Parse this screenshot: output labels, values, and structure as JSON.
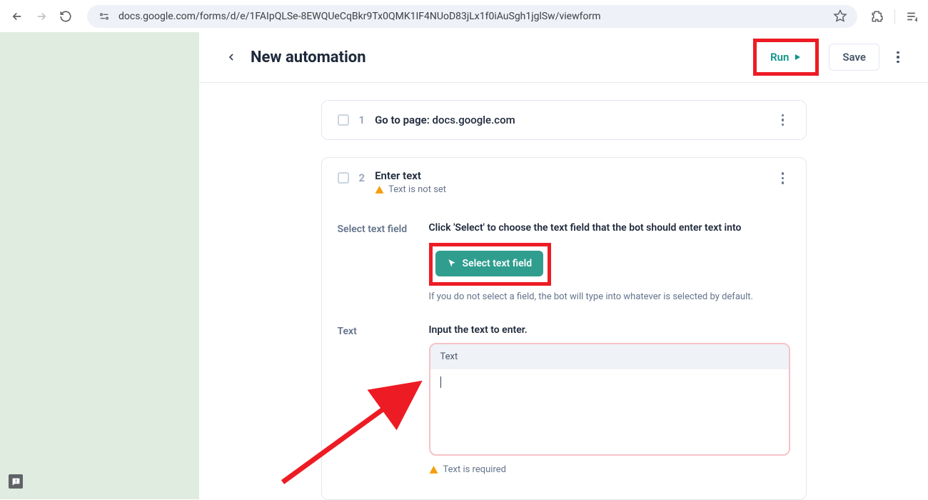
{
  "browser": {
    "url": "docs.google.com/forms/d/e/1FAIpQLSe-8EWQUeCqBkr9Tx0QMK1IF4NUoD83jLx1f0iAuSgh1jglSw/viewform"
  },
  "header": {
    "title": "New automation",
    "run_label": "Run",
    "save_label": "Save"
  },
  "steps": {
    "s1": {
      "num": "1",
      "title_prefix": "Go to page: ",
      "title_value": "docs.google.com"
    },
    "s2": {
      "num": "2",
      "title": "Enter text",
      "warn": "Text is not set",
      "field_select_label": "Select text field",
      "select_desc": "Click 'Select' to choose the text field that the bot should enter text into",
      "select_btn": "Select text field",
      "select_hint": "If you do not select a field, the bot will type into whatever is selected by default.",
      "field_text_label": "Text",
      "text_desc": "Input the text to enter.",
      "text_area_label": "Text",
      "text_value": "",
      "required_warn": "Text is required"
    }
  }
}
